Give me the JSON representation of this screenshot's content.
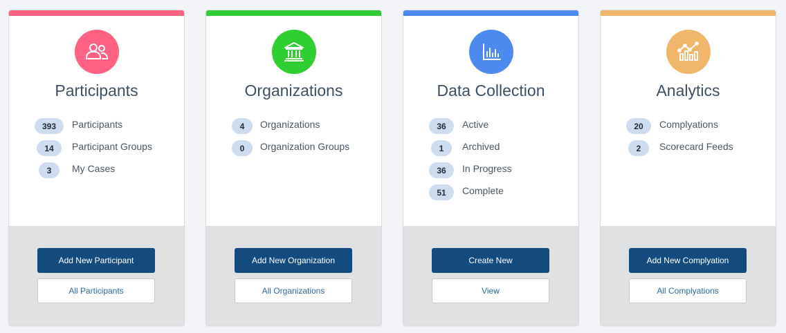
{
  "cards": [
    {
      "title": "Participants",
      "accent": "#ff6283",
      "icon": "users-icon",
      "stats": [
        {
          "count": "393",
          "label": "Participants"
        },
        {
          "count": "14",
          "label": "Participant Groups"
        },
        {
          "count": "3",
          "label": "My Cases"
        }
      ],
      "primary_button": "Add New Participant",
      "secondary_button": "All Participants"
    },
    {
      "title": "Organizations",
      "accent": "#2fcf31",
      "icon": "bank-building-icon",
      "stats": [
        {
          "count": "4",
          "label": "Organizations"
        },
        {
          "count": "0",
          "label": "Organization Groups"
        }
      ],
      "primary_button": "Add New Organization",
      "secondary_button": "All Organizations"
    },
    {
      "title": "Data Collection",
      "accent": "#4d8af0",
      "icon": "bar-chart-icon",
      "stats": [
        {
          "count": "36",
          "label": "Active"
        },
        {
          "count": "1",
          "label": "Archived"
        },
        {
          "count": "36",
          "label": "In Progress"
        },
        {
          "count": "51",
          "label": "Complete"
        }
      ],
      "primary_button": "Create New",
      "secondary_button": "View"
    },
    {
      "title": "Analytics",
      "accent": "#f0b76a",
      "icon": "analytics-chart-icon",
      "stats": [
        {
          "count": "20",
          "label": "Complyations"
        },
        {
          "count": "2",
          "label": "Scorecard Feeds"
        }
      ],
      "primary_button": "Add New Complyation",
      "secondary_button": "All Complyations"
    }
  ]
}
